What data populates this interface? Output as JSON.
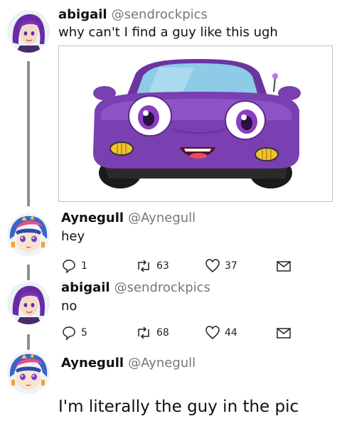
{
  "tweets": [
    {
      "name": "abigail",
      "handle": "@sendrockpics",
      "text": "why can't I find a guy like this ugh",
      "avatar_icon": "abigail-avatar-icon",
      "image_alt": "purple cartoon car with big eyes and smile"
    },
    {
      "name": "Aynegull",
      "handle": "@Aynegull",
      "text": "hey",
      "avatar_icon": "aynegull-avatar-icon",
      "replies": "1",
      "retweets": "63",
      "likes": "37"
    },
    {
      "name": "abigail",
      "handle": "@sendrockpics",
      "text": "no",
      "avatar_icon": "abigail-avatar-icon",
      "replies": "5",
      "retweets": "68",
      "likes": "44"
    },
    {
      "name": "Aynegull",
      "handle": "@Aynegull",
      "text": "I'm literally the guy in the pic",
      "avatar_icon": "aynegull-avatar-icon"
    }
  ],
  "colors": {
    "thread_line": "#8f8f8f",
    "handle": "#777777",
    "car_body": "#7a3fb0",
    "windshield": "#8ecbe6"
  }
}
